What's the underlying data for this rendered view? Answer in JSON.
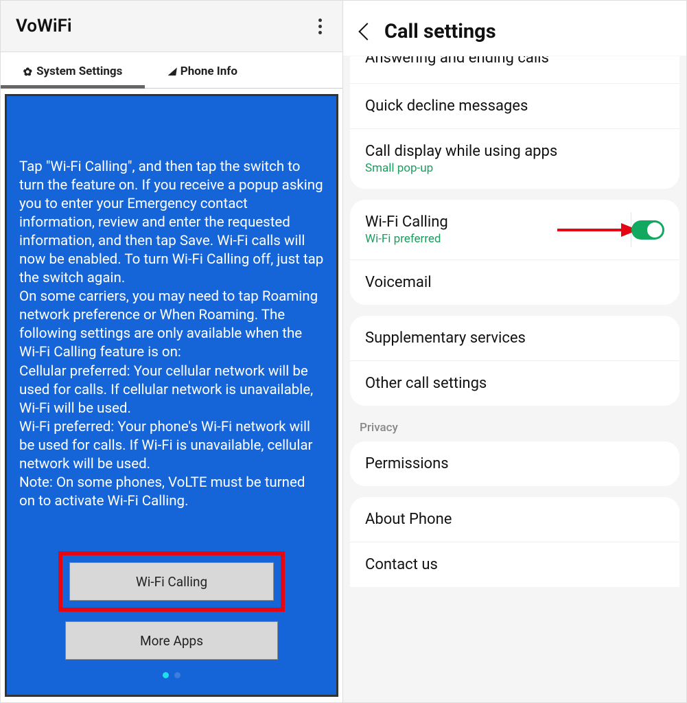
{
  "left": {
    "title": "VoWiFi",
    "tabs": {
      "system_settings": "System Settings",
      "phone_info": "Phone Info"
    },
    "instructions": "Tap \"Wi-Fi Calling\", and then tap the switch to turn the feature on. If you receive a popup asking you to enter your Emergency contact information, review and enter the requested information, and then tap Save. Wi-Fi calls will now be enabled. To turn Wi-Fi Calling off, just tap the switch again.\nOn some carriers, you may need to tap Roaming network preference or When Roaming. The following settings are only available when the Wi-Fi Calling feature is on:\nCellular preferred: Your cellular network will be used for calls. If cellular network is unavailable, Wi-Fi will be used.\nWi-Fi preferred: Your phone's Wi-Fi network will be used for calls. If Wi-Fi is unavailable, cellular network will be used.\nNote: On some phones, VoLTE must be turned on to activate Wi-Fi Calling.",
    "buttons": {
      "wifi_calling": "Wi-Fi Calling",
      "more_apps": "More Apps"
    }
  },
  "right": {
    "title": "Call settings",
    "truncated_top": "Answering and ending calls",
    "group1": {
      "quick_decline": "Quick decline messages",
      "call_display": "Call display while using apps",
      "call_display_sub": "Small pop-up"
    },
    "group2": {
      "wifi_calling": "Wi-Fi Calling",
      "wifi_calling_sub": "Wi-Fi preferred",
      "wifi_calling_on": true,
      "voicemail": "Voicemail"
    },
    "group3": {
      "supplementary": "Supplementary services",
      "other": "Other call settings"
    },
    "privacy_label": "Privacy",
    "group4": {
      "permissions": "Permissions"
    },
    "group5": {
      "about": "About Phone",
      "contact": "Contact us"
    }
  }
}
